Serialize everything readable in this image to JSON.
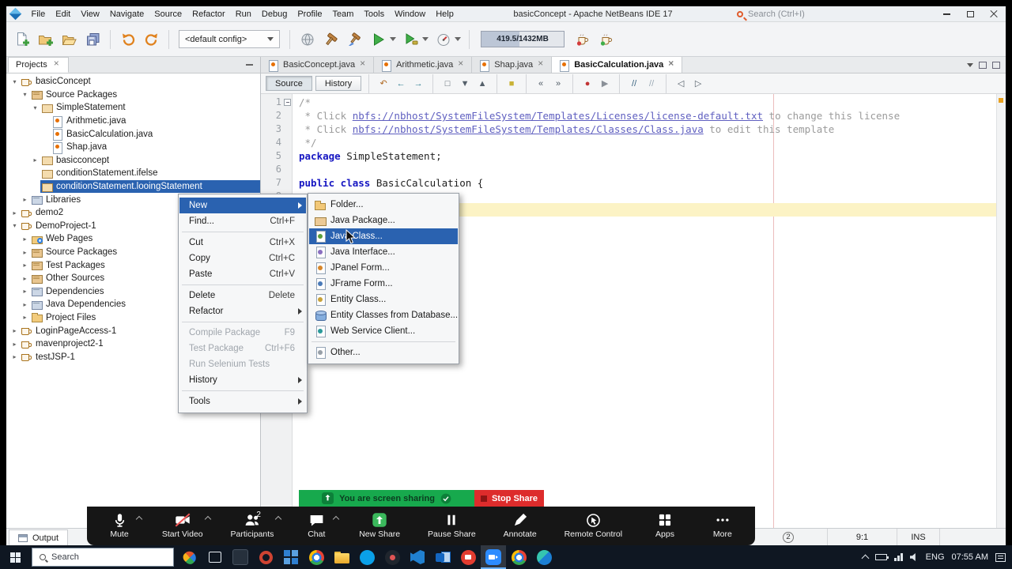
{
  "titlebar": {
    "menus": [
      "File",
      "Edit",
      "View",
      "Navigate",
      "Source",
      "Refactor",
      "Run",
      "Debug",
      "Profile",
      "Team",
      "Tools",
      "Window",
      "Help"
    ],
    "title": "basicConcept - Apache NetBeans IDE 17",
    "search_placeholder": "Search (Ctrl+I)"
  },
  "toolbar": {
    "buttons_left": [
      "new-file",
      "new-project",
      "open-project",
      "save-all"
    ],
    "history_buttons": [
      "undo",
      "redo"
    ],
    "config": "<default config>",
    "buttons_run": [
      "deploy",
      "build",
      "clean-build",
      "run",
      "debug",
      "profile"
    ],
    "memory": "419.5/1432MB",
    "buttons_right": [
      "cup-red",
      "cup-green"
    ]
  },
  "projects_panel": {
    "tab": "Projects",
    "tree": [
      {
        "label": "basicConcept",
        "indent": 0,
        "arrow": "expanded",
        "icon": "project"
      },
      {
        "label": "Source Packages",
        "indent": 1,
        "arrow": "expanded",
        "icon": "sources"
      },
      {
        "label": "SimpleStatement",
        "indent": 2,
        "arrow": "expanded",
        "icon": "package"
      },
      {
        "label": "Arithmetic.java",
        "indent": 3,
        "arrow": "none",
        "icon": "java"
      },
      {
        "label": "BasicCalculation.java",
        "indent": 3,
        "arrow": "none",
        "icon": "java"
      },
      {
        "label": "Shap.java",
        "indent": 3,
        "arrow": "none",
        "icon": "java"
      },
      {
        "label": "basicconcept",
        "indent": 2,
        "arrow": "collapsed",
        "icon": "package"
      },
      {
        "label": "conditionStatement.ifelse",
        "indent": 2,
        "arrow": "none",
        "icon": "package"
      },
      {
        "label": "conditionStatement.looingStatement",
        "indent": 2,
        "arrow": "none",
        "icon": "package",
        "selected": true
      },
      {
        "label": "Libraries",
        "indent": 1,
        "arrow": "collapsed",
        "icon": "libraries"
      },
      {
        "label": "demo2",
        "indent": 0,
        "arrow": "collapsed",
        "icon": "project"
      },
      {
        "label": "DemoProject-1",
        "indent": 0,
        "arrow": "expanded",
        "icon": "project"
      },
      {
        "label": "Web Pages",
        "indent": 1,
        "arrow": "collapsed",
        "icon": "folder-web"
      },
      {
        "label": "Source Packages",
        "indent": 1,
        "arrow": "collapsed",
        "icon": "sources"
      },
      {
        "label": "Test Packages",
        "indent": 1,
        "arrow": "collapsed",
        "icon": "sources"
      },
      {
        "label": "Other Sources",
        "indent": 1,
        "arrow": "collapsed",
        "icon": "sources"
      },
      {
        "label": "Dependencies",
        "indent": 1,
        "arrow": "collapsed",
        "icon": "libraries"
      },
      {
        "label": "Java Dependencies",
        "indent": 1,
        "arrow": "collapsed",
        "icon": "libraries"
      },
      {
        "label": "Project Files",
        "indent": 1,
        "arrow": "collapsed",
        "icon": "folder"
      },
      {
        "label": "LoginPageAccess-1",
        "indent": 0,
        "arrow": "collapsed",
        "icon": "project"
      },
      {
        "label": "mavenproject2-1",
        "indent": 0,
        "arrow": "collapsed",
        "icon": "project"
      },
      {
        "label": "testJSP-1",
        "indent": 0,
        "arrow": "collapsed",
        "icon": "project"
      }
    ]
  },
  "editor": {
    "tabs": [
      {
        "label": "BasicConcept.java",
        "active": false
      },
      {
        "label": "Arithmetic.java",
        "active": false
      },
      {
        "label": "Shap.java",
        "active": false
      },
      {
        "label": "BasicCalculation.java",
        "active": true
      }
    ],
    "view_buttons": [
      "Source",
      "History"
    ],
    "toolbar_icons": [
      "last-edit",
      "back",
      "forward",
      "|",
      "find-selection",
      "find-next",
      "find-previous",
      "|",
      "highlight",
      "|",
      "prev-bookmark",
      "next-bookmark",
      "|",
      "record-macro",
      "run-macro",
      "|",
      "comment",
      "uncomment",
      "|",
      "shift-left",
      "shift-right"
    ],
    "code_lines": [
      {
        "num": 1,
        "fold": true,
        "segments": [
          {
            "text": "/*",
            "type": "comment"
          }
        ]
      },
      {
        "num": 2,
        "segments": [
          {
            "text": " * Click ",
            "type": "comment"
          },
          {
            "text": "nbfs://nbhost/SystemFileSystem/Templates/Licenses/license-default.txt",
            "type": "link"
          },
          {
            "text": " to change this license",
            "type": "comment"
          }
        ]
      },
      {
        "num": 3,
        "segments": [
          {
            "text": " * Click ",
            "type": "comment"
          },
          {
            "text": "nbfs://nbhost/SystemFileSystem/Templates/Classes/Class.java",
            "type": "link"
          },
          {
            "text": " to edit this template",
            "type": "comment"
          }
        ]
      },
      {
        "num": 4,
        "segments": [
          {
            "text": " */",
            "type": "comment"
          }
        ]
      },
      {
        "num": 5,
        "segments": [
          {
            "text": "package",
            "type": "keyword"
          },
          {
            "text": " SimpleStatement;",
            "type": "plain"
          }
        ]
      },
      {
        "num": 6,
        "segments": []
      },
      {
        "num": 7,
        "segments": [
          {
            "text": "public class",
            "type": "keyword"
          },
          {
            "text": " BasicCalculation {",
            "type": "plain"
          }
        ]
      },
      {
        "num": 8,
        "segments": []
      },
      {
        "num": 9,
        "current": true,
        "segments": []
      }
    ]
  },
  "context_menu": {
    "items": [
      {
        "label": "New",
        "submenu": true,
        "highlighted": true
      },
      {
        "label": "Find...",
        "shortcut": "Ctrl+F"
      },
      {
        "type": "sep"
      },
      {
        "label": "Cut",
        "shortcut": "Ctrl+X"
      },
      {
        "label": "Copy",
        "shortcut": "Ctrl+C"
      },
      {
        "label": "Paste",
        "shortcut": "Ctrl+V"
      },
      {
        "type": "sep"
      },
      {
        "label": "Delete",
        "shortcut": "Delete"
      },
      {
        "label": "Refactor",
        "submenu": true
      },
      {
        "type": "sep"
      },
      {
        "label": "Compile Package",
        "shortcut": "F9",
        "disabled": true
      },
      {
        "label": "Test Package",
        "shortcut": "Ctrl+F6",
        "disabled": true
      },
      {
        "label": "Run Selenium Tests",
        "disabled": true
      },
      {
        "label": "History",
        "submenu": true
      },
      {
        "type": "sep"
      },
      {
        "label": "Tools",
        "submenu": true
      }
    ]
  },
  "new_submenu": {
    "items": [
      {
        "label": "Folder...",
        "icon": "folder"
      },
      {
        "label": "Java Package...",
        "icon": "package"
      },
      {
        "label": "Java Class...",
        "icon": "class",
        "highlighted": true
      },
      {
        "label": "Java Interface...",
        "icon": "interface"
      },
      {
        "label": "JPanel Form...",
        "icon": "jpanel"
      },
      {
        "label": "JFrame Form...",
        "icon": "jframe"
      },
      {
        "label": "Entity Class...",
        "icon": "entity"
      },
      {
        "label": "Entity Classes from Database...",
        "icon": "entity-db"
      },
      {
        "label": "Web Service Client...",
        "icon": "ws-client"
      },
      {
        "type": "sep"
      },
      {
        "label": "Other...",
        "icon": "other"
      }
    ]
  },
  "zoom": {
    "banner_text": "You are screen sharing",
    "stop_button": "Stop Share",
    "buttons": [
      {
        "label": "Mute",
        "icon": "mic",
        "caret": true
      },
      {
        "label": "Start Video",
        "icon": "video-off",
        "caret": true
      },
      {
        "label": "Participants",
        "icon": "participants",
        "badge": "2",
        "caret": true
      },
      {
        "label": "Chat",
        "icon": "chat",
        "caret": true
      },
      {
        "label": "New Share",
        "icon": "share",
        "accent": true
      },
      {
        "label": "Pause Share",
        "icon": "pause"
      },
      {
        "label": "Annotate",
        "icon": "annotate"
      },
      {
        "label": "Remote Control",
        "icon": "remote"
      },
      {
        "label": "Apps",
        "icon": "apps"
      },
      {
        "label": "More",
        "icon": "more"
      }
    ]
  },
  "status_bar": {
    "output_label": "Output",
    "notification_badge": "2",
    "caret_position": "9:1",
    "insert_mode": "INS"
  },
  "taskbar": {
    "search_placeholder": "Search",
    "apps": [
      {
        "name": "butterfly"
      },
      {
        "name": "task-view"
      },
      {
        "name": "app-dark"
      },
      {
        "name": "oracle"
      },
      {
        "name": "grid-blue"
      },
      {
        "name": "chrome"
      },
      {
        "name": "file-explorer"
      },
      {
        "name": "skype"
      },
      {
        "name": "cam-dark"
      },
      {
        "name": "vscode"
      },
      {
        "name": "outlook"
      },
      {
        "name": "app-red"
      },
      {
        "name": "zoom",
        "active": true
      },
      {
        "name": "chrome-2"
      },
      {
        "name": "edge"
      }
    ],
    "tray": {
      "language": "ENG",
      "time": "07:55 AM"
    }
  },
  "colors": {
    "selection_blue": "#2a62b0",
    "menu_highlight": "#2a62b0",
    "share_green": "#17a94d",
    "stop_red": "#dd2c2c",
    "zoom_accent_green": "#3bb85c",
    "keyword_blue": "#1616c2",
    "comment_gray": "#9b9b9b"
  }
}
